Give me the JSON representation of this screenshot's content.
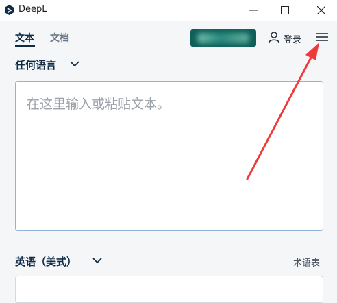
{
  "window": {
    "title": "DeepL"
  },
  "tabs": [
    {
      "label": "文本",
      "active": true
    },
    {
      "label": "文档",
      "active": false
    }
  ],
  "header": {
    "login_label": "登录"
  },
  "source": {
    "language": "任何语言",
    "placeholder": "在这里输入或粘贴文本。"
  },
  "target": {
    "language": "英语（美式）",
    "glossary_label": "术语表"
  },
  "colors": {
    "brand_dark": "#0f2b46",
    "promo_bg": "#0f5f5a",
    "input_border": "#8fb4d6",
    "annotation_arrow": "#f03a3a"
  },
  "icons": [
    "deepl-logo-icon",
    "minimize-icon",
    "maximize-icon",
    "close-icon",
    "user-icon",
    "hamburger-menu-icon",
    "chevron-down-icon"
  ]
}
